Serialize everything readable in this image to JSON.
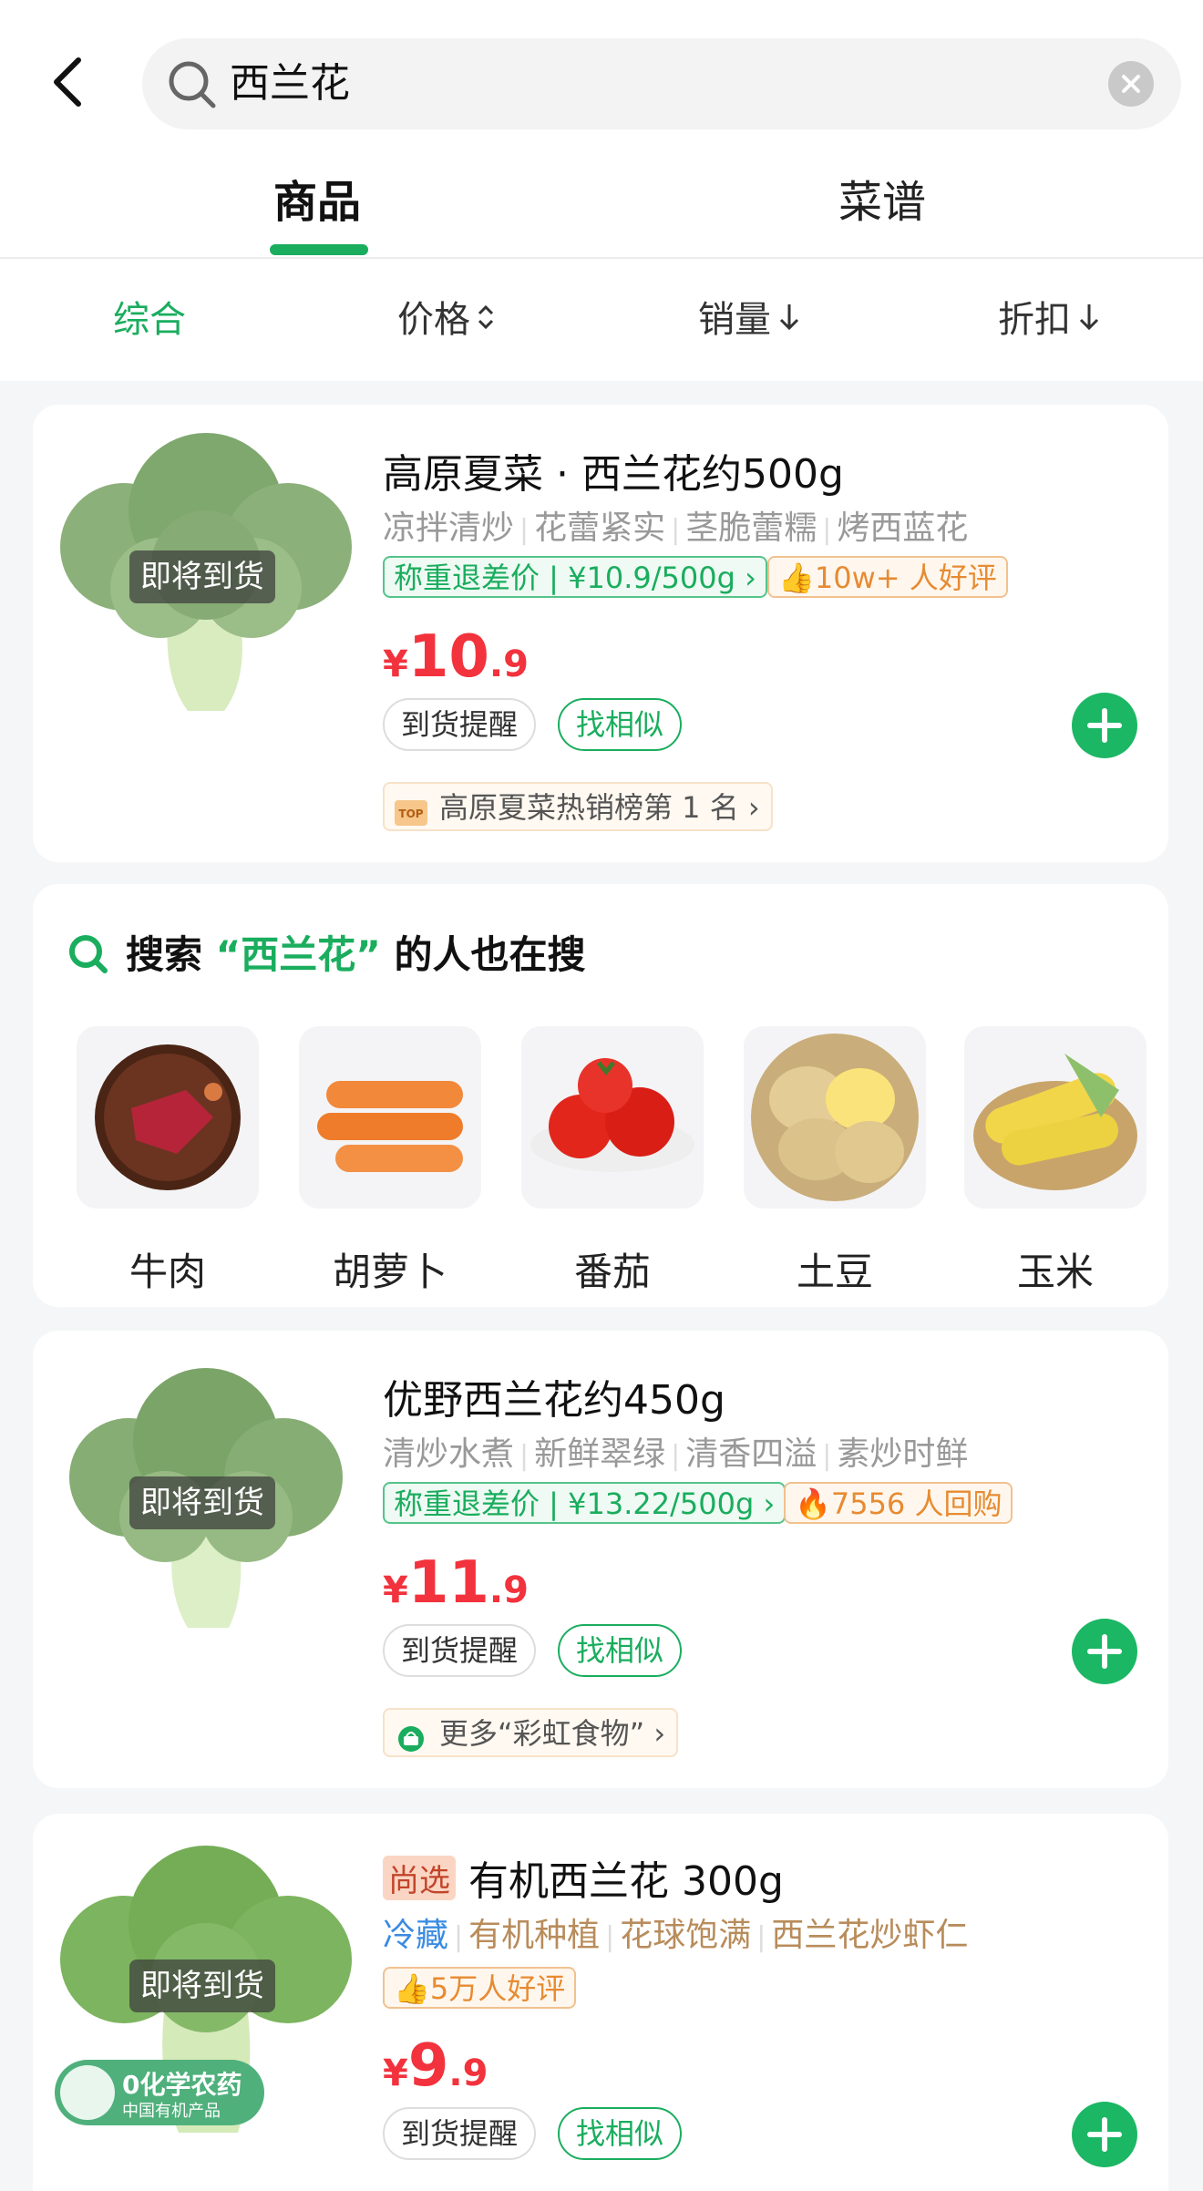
{
  "search": {
    "query": "西兰花"
  },
  "tabs": [
    {
      "label": "商品"
    },
    {
      "label": "菜谱"
    }
  ],
  "filters": [
    {
      "label": "综合"
    },
    {
      "label": "价格"
    },
    {
      "label": "销量"
    },
    {
      "label": "折扣"
    }
  ],
  "products": [
    {
      "badge": "即将到货",
      "title": "高原夏菜 · 西兰花约500g",
      "tags": [
        "凉拌清炒",
        "花蕾紧实",
        "茎脆蕾糯",
        "烤西蓝花"
      ],
      "price_tag": "称重退差价 | ¥10.9/500g",
      "social": "10w+ 人好评",
      "price": {
        "currency": "¥",
        "int": "10",
        "dec": ".9"
      },
      "remind": "到货提醒",
      "similar": "找相似",
      "rank": "高原夏菜热销榜第 1 名"
    },
    {
      "badge": "即将到货",
      "title": "优野西兰花约450g",
      "tags": [
        "清炒水煮",
        "新鲜翠绿",
        "清香四溢",
        "素炒时鲜"
      ],
      "price_tag": "称重退差价 | ¥13.22/500g",
      "social": "7556 人回购",
      "price": {
        "currency": "¥",
        "int": "11",
        "dec": ".9"
      },
      "remind": "到货提醒",
      "similar": "找相似",
      "more": "更多“彩虹食物”"
    },
    {
      "badge": "即将到货",
      "label_tag": "尚选",
      "title": "有机西兰花 300g",
      "tags": [
        "冷藏",
        "有机种植",
        "花球饱满",
        "西兰花炒虾仁"
      ],
      "social": "5万人好评",
      "price": {
        "currency": "¥",
        "int": "9",
        "dec": ".9"
      },
      "remind": "到货提醒",
      "similar": "找相似",
      "organic_title": "0化学农药",
      "organic_sub": "中国有机产品"
    }
  ],
  "also_searched": {
    "prefix": "搜索",
    "keyword": "“西兰花”",
    "suffix": "的人也在搜",
    "items": [
      {
        "name": "牛肉"
      },
      {
        "name": "胡萝卜"
      },
      {
        "name": "番茄"
      },
      {
        "name": "土豆"
      },
      {
        "name": "玉米"
      }
    ]
  },
  "colors": {
    "brand_green": "#1aad5e",
    "price_red": "#f2323c",
    "tag_orange": "#e78b32"
  }
}
